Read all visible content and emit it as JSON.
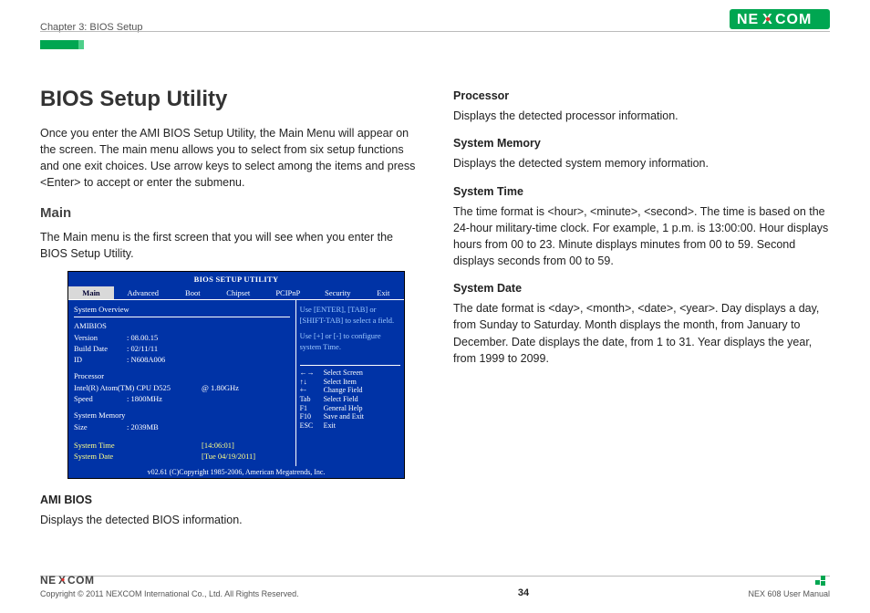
{
  "header": {
    "chapter": "Chapter 3: BIOS Setup",
    "brand": "NEXCOM"
  },
  "left": {
    "h1": "BIOS Setup Utility",
    "intro": "Once you enter the AMI BIOS Setup Utility, the Main Menu will appear on the screen. The main menu allows you to select from six setup functions and one exit choices. Use arrow keys to select among the items and press <Enter> to accept or enter the submenu.",
    "h2": "Main",
    "main_p": "The Main menu is the first screen that you will see when you enter the BIOS Setup Utility.",
    "amibios_h": "AMI BIOS",
    "amibios_p": "Displays the detected BIOS information."
  },
  "right": {
    "proc_h": "Processor",
    "proc_p": "Displays the detected processor information.",
    "mem_h": "System Memory",
    "mem_p": "Displays the detected system memory information.",
    "time_h": "System Time",
    "time_p": "The time format is <hour>, <minute>, <second>. The time is based on the 24-hour military-time clock. For example, 1 p.m. is 13:00:00. Hour displays hours from 00 to 23. Minute displays minutes from 00 to 59. Second displays seconds from 00 to 59.",
    "date_h": "System Date",
    "date_p": "The date format is <day>, <month>, <date>, <year>. Day displays a day, from Sunday to Saturday. Month displays the month, from January to December. Date displays the date, from 1 to 31. Year displays the year, from 1999 to 2099."
  },
  "bios": {
    "title": "BIOS SETUP UTILITY",
    "menu": [
      "Main",
      "Advanced",
      "Boot",
      "Chipset",
      "PCIPnP",
      "Security",
      "Exit"
    ],
    "overview": "System Overview",
    "ami_h": "AMIBIOS",
    "ver_k": "Version",
    "ver_v": ": 08.00.15",
    "bd_k": "Build Date",
    "bd_v": ": 02/11/11",
    "id_k": "ID",
    "id_v": ": N608A006",
    "proc_h": "Processor",
    "proc_l": "Intel(R) Atom(TM) CPU D525",
    "proc_r": "@ 1.80GHz",
    "speed_k": "Speed",
    "speed_v": ": 1800MHz",
    "mem_h": "System Memory",
    "size_k": "Size",
    "size_v": ": 2039MB",
    "stime_k": "System Time",
    "stime_v": "[14:06:01]",
    "sdate_k": "System Date",
    "sdate_v": "[Tue 04/19/2011]",
    "help1": "Use [ENTER], [TAB] or [SHIFT-TAB] to select a field.",
    "help2": "Use [+] or [-] to configure system Time.",
    "keys": [
      {
        "k": "←→",
        "v": "Select Screen"
      },
      {
        "k": "↑↓",
        "v": "Select Item"
      },
      {
        "k": "+-",
        "v": "Change Field"
      },
      {
        "k": "Tab",
        "v": "Select Field"
      },
      {
        "k": "F1",
        "v": "General Help"
      },
      {
        "k": "F10",
        "v": "Save and Exit"
      },
      {
        "k": "ESC",
        "v": "Exit"
      }
    ],
    "foot": "v02.61 (C)Copyright 1985-2006, American Megatrends, Inc."
  },
  "footer": {
    "copy": "Copyright © 2011 NEXCOM International Co., Ltd. All Rights Reserved.",
    "page": "34",
    "manual": "NEX 608 User Manual"
  }
}
